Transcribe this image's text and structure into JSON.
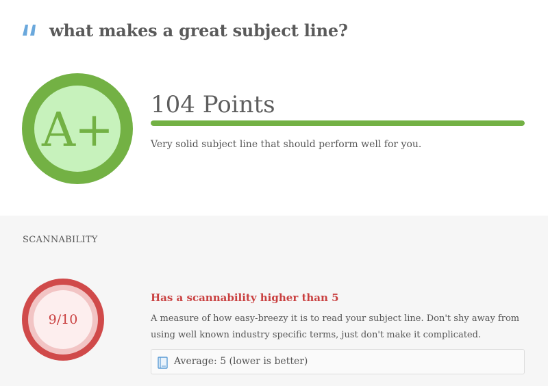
{
  "header": {
    "icon": "quote-icon",
    "headline": "what makes a great subject line?"
  },
  "grade": {
    "letter": "A+",
    "points_label": "104 Points",
    "progress": 1.0,
    "description": "Very solid subject line that should perform well for you.",
    "ring_color": "#73b144",
    "inner_color": "#c7f2bc"
  },
  "scannability": {
    "section_title": "SCANNABILITY",
    "score": "9/10",
    "heading": "Has a scannability higher than 5",
    "description": "A measure of how easy-breezy it is to read your subject line. Don't shy away from using well known industry specific terms, just don't make it complicated.",
    "average_icon": "book-icon",
    "average_text": "Average: 5 (lower is better)",
    "ring_color": "#d04a4a",
    "text_color": "#c94040"
  }
}
